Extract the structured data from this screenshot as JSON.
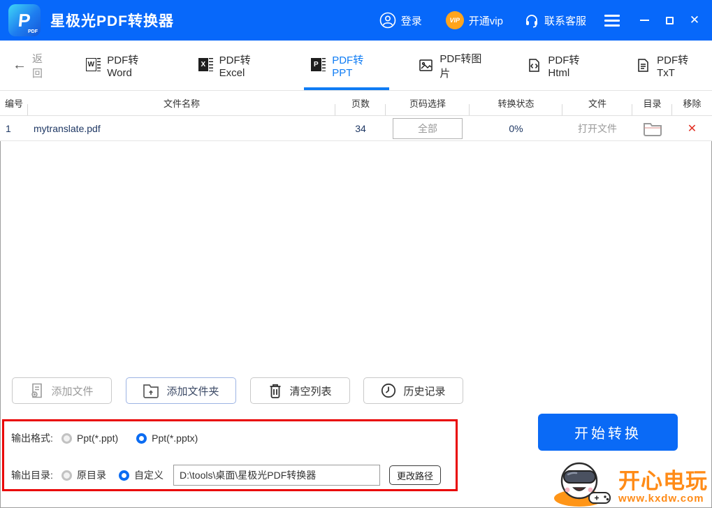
{
  "app": {
    "title": "星极光PDF转换器",
    "logo_letter": "P",
    "logo_sub": "PDF"
  },
  "header": {
    "login_label": "登录",
    "vip_badge": "VIP",
    "vip_label": "开通vip",
    "service_label": "联系客服"
  },
  "icons": {
    "back_arrow": "←",
    "close": "✕",
    "remove": "✕",
    "html_glyph": "</>",
    "folder_arrow": "↑"
  },
  "nav": {
    "back_label": "返回",
    "tabs": [
      {
        "label": "PDF转Word",
        "letter": "W",
        "active": false
      },
      {
        "label": "PDF转Excel",
        "letter": "X",
        "active": false
      },
      {
        "label": "PDF转PPT",
        "letter": "P",
        "active": true
      },
      {
        "label": "PDF转图片",
        "active": false
      },
      {
        "label": "PDF转Html",
        "active": false
      },
      {
        "label": "PDF转TxT",
        "active": false
      }
    ]
  },
  "table": {
    "columns": [
      "编号",
      "文件名称",
      "页数",
      "页码选择",
      "转换状态",
      "文件",
      "目录",
      "移除"
    ],
    "rows": [
      {
        "id": "1",
        "name": "mytranslate.pdf",
        "pages": "34",
        "page_select": "全部",
        "status": "0%",
        "open_label": "打开文件"
      }
    ]
  },
  "actions": [
    {
      "label": "添加文件"
    },
    {
      "label": "添加文件夹"
    },
    {
      "label": "清空列表"
    },
    {
      "label": "历史记录"
    }
  ],
  "output": {
    "format_label": "输出格式:",
    "format_options": [
      {
        "label": "Ppt(*.ppt)",
        "selected": false
      },
      {
        "label": "Ppt(*.pptx)",
        "selected": true
      }
    ],
    "dir_label": "输出目录:",
    "dir_options": [
      {
        "label": "原目录",
        "selected": false
      },
      {
        "label": "自定义",
        "selected": true
      }
    ],
    "path_value": "D:\\tools\\桌面\\星极光PDF转换器",
    "change_path_label": "更改路径"
  },
  "convert_label": "开始转换",
  "watermark": {
    "title": "开心电玩",
    "url": "www.kxdw.com"
  },
  "colors": {
    "header_blue": "#0768fa",
    "active_tab_blue": "#0f7cf4",
    "highlight_red": "#e90202",
    "file_text_navy": "#1f3864",
    "remove_red": "#e23024",
    "watermark_orange": "#ff8b17",
    "vip_orange": "#ffa41c",
    "convert_blue": "#0a6af6"
  }
}
